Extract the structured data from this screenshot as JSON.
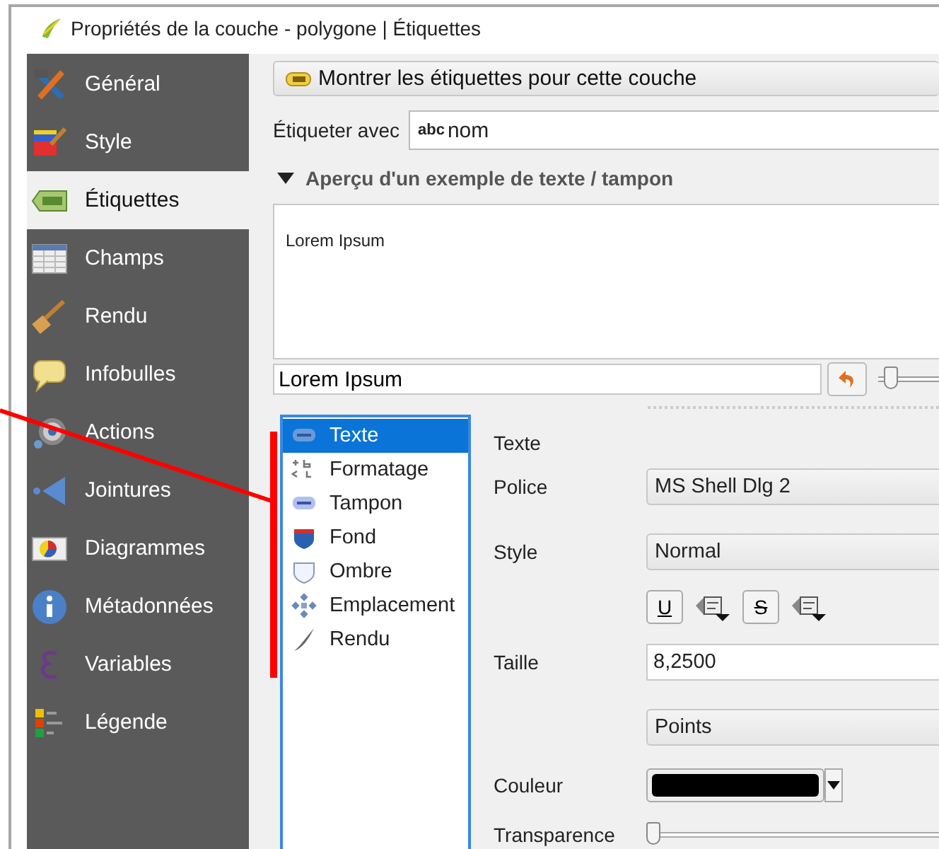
{
  "window": {
    "title": "Propriétés de la couche - polygone | Étiquettes"
  },
  "sidebar": {
    "items": [
      {
        "label": "Général",
        "selected": false
      },
      {
        "label": "Style",
        "selected": false
      },
      {
        "label": "Étiquettes",
        "selected": true
      },
      {
        "label": "Champs",
        "selected": false
      },
      {
        "label": "Rendu",
        "selected": false
      },
      {
        "label": "Infobulles",
        "selected": false
      },
      {
        "label": "Actions",
        "selected": false
      },
      {
        "label": "Jointures",
        "selected": false
      },
      {
        "label": "Diagrammes",
        "selected": false
      },
      {
        "label": "Métadonnées",
        "selected": false
      },
      {
        "label": "Variables",
        "selected": false
      },
      {
        "label": "Légende",
        "selected": false
      }
    ]
  },
  "show_labels_button": {
    "label": "Montrer les étiquettes pour cette couche"
  },
  "label_with": {
    "label": "Étiqueter avec",
    "tag": "abc",
    "value": "nom"
  },
  "preview": {
    "title": "Aperçu d'un exemple de texte / tampon",
    "expanded": true,
    "sample": "Lorem Ipsum",
    "input": "Lorem Ipsum",
    "slider": {
      "level": 0.1
    }
  },
  "sub_tabs": [
    {
      "label": "Texte",
      "selected": true
    },
    {
      "label": "Formatage",
      "selected": false
    },
    {
      "label": "Tampon",
      "selected": false
    },
    {
      "label": "Fond",
      "selected": false
    },
    {
      "label": "Ombre",
      "selected": false
    },
    {
      "label": "Emplacement",
      "selected": false
    },
    {
      "label": "Rendu",
      "selected": false
    }
  ],
  "text_section": {
    "title": "Texte",
    "rows": [
      {
        "kind": "select",
        "label": "Police",
        "value": "MS Shell Dlg 2"
      },
      {
        "kind": "select",
        "label": "Style",
        "value": "Normal"
      },
      {
        "kind": "buttons",
        "buttons": [
          "U",
          "S"
        ]
      },
      {
        "kind": "input",
        "label": "Taille",
        "value": "8,2500"
      },
      {
        "kind": "select",
        "value": "Points"
      },
      {
        "kind": "color",
        "label": "Couleur",
        "color": "#000000"
      },
      {
        "kind": "slider",
        "label": "Transparence",
        "level": 0
      }
    ]
  }
}
